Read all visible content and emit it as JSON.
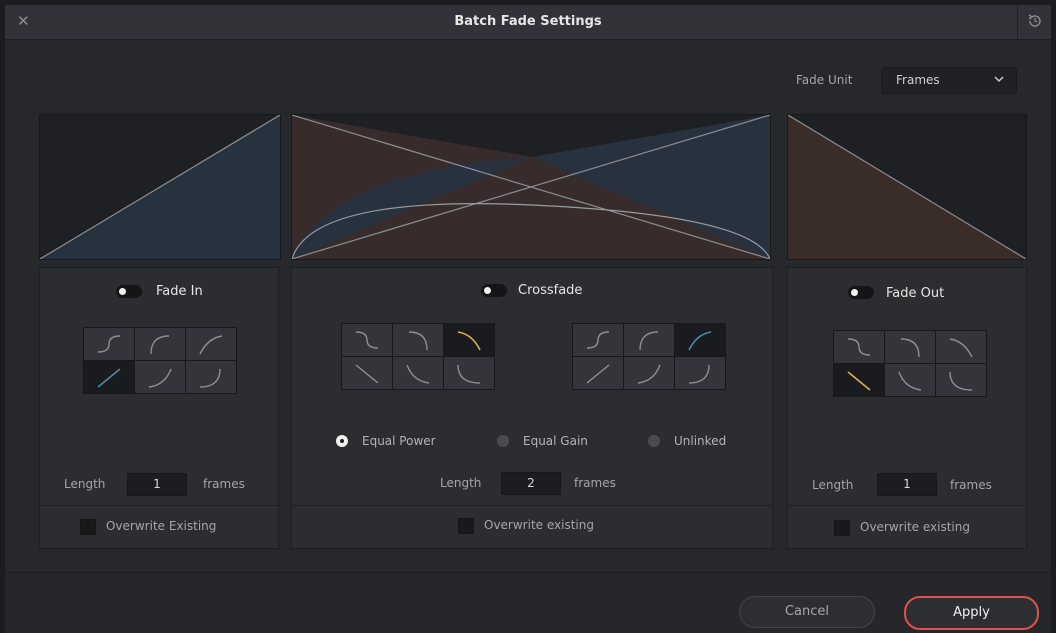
{
  "window": {
    "title": "Batch Fade Settings"
  },
  "fade_unit": {
    "label": "Fade Unit",
    "value": "Frames"
  },
  "fade_in": {
    "label": "Fade In",
    "length_label": "Length",
    "length_value": "1",
    "unit": "frames",
    "overwrite_label": "Overwrite Existing"
  },
  "crossfade": {
    "label": "Crossfade",
    "length_label": "Length",
    "length_value": "2",
    "unit": "frames",
    "overwrite_label": "Overwrite existing",
    "modes": [
      {
        "label": "Equal Power",
        "selected": true
      },
      {
        "label": "Equal Gain",
        "selected": false
      },
      {
        "label": "Unlinked",
        "selected": false
      }
    ]
  },
  "fade_out": {
    "label": "Fade Out",
    "length_label": "Length",
    "length_value": "1",
    "unit": "frames",
    "overwrite_label": "Overwrite existing"
  },
  "buttons": {
    "cancel": "Cancel",
    "apply": "Apply"
  },
  "colors": {
    "accent_yellow": "#d9b24a",
    "accent_blue": "#4c8aa8",
    "apply_border": "#e0514f",
    "fade_fill_blue": "#28323f",
    "fade_fill_brown": "#3a2c28"
  },
  "icons": [
    "close-icon",
    "reset-icon",
    "chevron-down-icon",
    "fade-curve-icon"
  ]
}
